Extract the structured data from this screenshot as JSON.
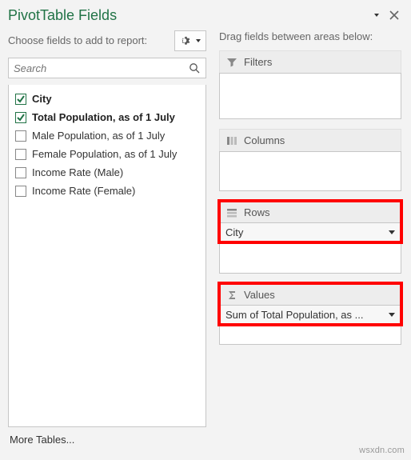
{
  "header": {
    "title": "PivotTable Fields"
  },
  "left": {
    "instruction": "Choose fields to add to report:",
    "search_placeholder": "Search",
    "more_tables": "More Tables...",
    "fields": [
      {
        "label": "City",
        "checked": true
      },
      {
        "label": "Total Population, as of 1 July",
        "checked": true
      },
      {
        "label": "Male Population, as of 1 July",
        "checked": false
      },
      {
        "label": "Female Population, as of 1 July",
        "checked": false
      },
      {
        "label": "Income Rate (Male)",
        "checked": false
      },
      {
        "label": "Income Rate (Female)",
        "checked": false
      }
    ]
  },
  "right": {
    "instruction": "Drag fields between areas below:",
    "areas": {
      "filters": {
        "label": "Filters",
        "items": []
      },
      "columns": {
        "label": "Columns",
        "items": []
      },
      "rows": {
        "label": "Rows",
        "items": [
          "City"
        ]
      },
      "values": {
        "label": "Values",
        "items": [
          "Sum of Total Population, as ..."
        ]
      }
    }
  },
  "watermark": "wsxdn.com"
}
